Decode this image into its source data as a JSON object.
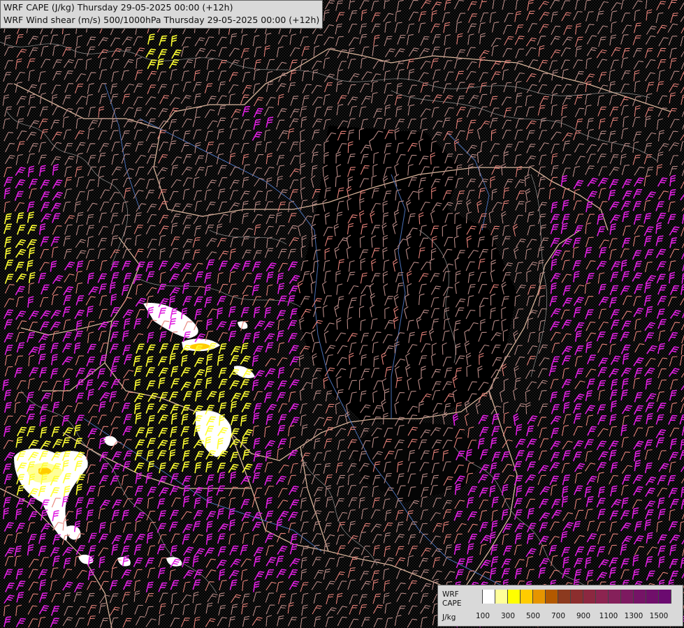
{
  "titles": {
    "line1": "WRF CAPE (J/kg) Thursday 29-05-2025 00:00 (+12h)",
    "line2": "WRF Wind shear (m/s) 500/1000hPa Thursday 29-05-2025 00:00 (+12h)"
  },
  "legend": {
    "title1": "WRF",
    "title2": "CAPE",
    "unit": "J/kg",
    "ticks": [
      "100",
      "300",
      "500",
      "700",
      "900",
      "1100",
      "1300",
      "1500"
    ],
    "colors": [
      "#d9d9d9",
      "#ffffff",
      "#ffff99",
      "#ffff00",
      "#ffcc00",
      "#e69500",
      "#b35900",
      "#8c3a1f",
      "#8c2e2e",
      "#8c2840",
      "#8c2450",
      "#85205a",
      "#7d1a60",
      "#751466",
      "#700f6a",
      "#6b0a70"
    ]
  },
  "colors": {
    "background": "#000000",
    "borders": "#d8b49a",
    "rivers": "#4a6fb5",
    "terrain": "#a0a0a0",
    "barb_low": "#b88a86",
    "barb_mid": "#e8827a",
    "barb_high": "#e020e0",
    "barb_cape": "#ffff33"
  }
}
